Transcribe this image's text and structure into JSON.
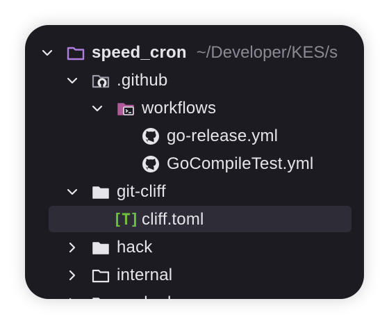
{
  "colors": {
    "panel_bg": "#1c1b22",
    "selected_bg": "#2d2c37",
    "text": "#e6e6ea",
    "muted": "#8b8a94",
    "project_folder": "#b07ee0",
    "workflows_folder": "#b05a9a",
    "toml_green": "#6fbf3a"
  },
  "tree": {
    "project": {
      "name": "speed_cron",
      "path": "~/Developer/KES/s",
      "icon": "folder-outline-icon",
      "expanded": true
    },
    "items": [
      {
        "label": ".github",
        "icon": "github-folder-icon",
        "expanded": true
      },
      {
        "label": "workflows",
        "icon": "workflows-folder-icon",
        "expanded": true
      },
      {
        "label": "go-release.yml",
        "icon": "github-icon"
      },
      {
        "label": "GoCompileTest.yml",
        "icon": "github-icon"
      },
      {
        "label": "git-cliff",
        "icon": "folder-icon",
        "expanded": true
      },
      {
        "label": "cliff.toml",
        "icon": "toml-icon",
        "icon_text": "[T]",
        "selected": true
      },
      {
        "label": "hack",
        "icon": "folder-icon",
        "expanded": false
      },
      {
        "label": "internal",
        "icon": "folder-outline-icon",
        "expanded": false
      },
      {
        "label": "packed",
        "icon": "folder-icon",
        "expanded": false
      }
    ]
  }
}
